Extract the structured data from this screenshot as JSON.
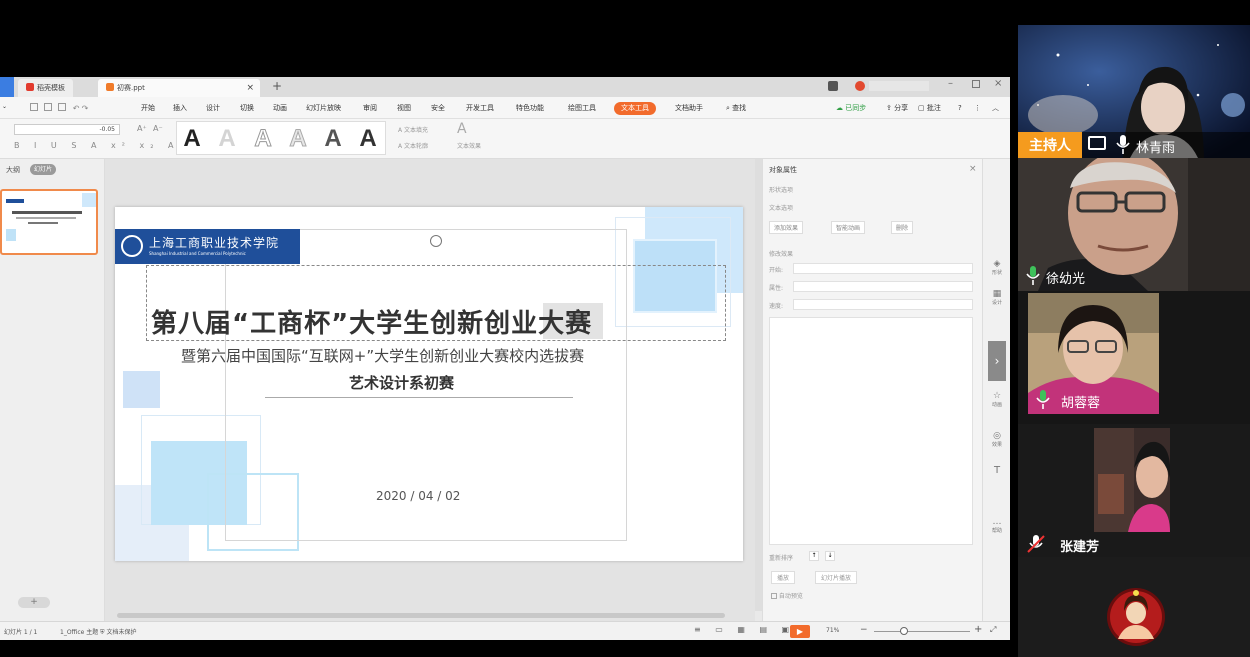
{
  "screen": {
    "tabs": [
      {
        "label": "稻壳模板"
      },
      {
        "label": "初赛.ppt"
      }
    ],
    "menu": [
      "开始",
      "插入",
      "设计",
      "切换",
      "动画",
      "幻灯片放映",
      "审阅",
      "视图",
      "安全",
      "开发工具",
      "特色功能",
      "绘图工具",
      "文本工具",
      "文档助手",
      "查找"
    ],
    "menu_right": [
      "已同步",
      "分享",
      "批注"
    ],
    "ribbon": {
      "font_size": "-0.05",
      "text_fill": "文本填充",
      "text_outline": "文本轮廓",
      "text_effect": "文本效果"
    },
    "left_panel": {
      "outline_tab": "大纲",
      "slides_tab": "幻灯片"
    },
    "slide": {
      "logo_text": "上海工商职业技术学院",
      "logo_subtext": "Shanghai Industrial and Commercial Polytechnic",
      "title": "第八届“工商杯”大学生创新创业大赛",
      "subtitle": "暨第六届中国国际“互联网+”大学生创新创业大赛校内选拔赛",
      "department": "艺术设计系初赛",
      "date": "2020 / 04 / 02"
    },
    "right_panel": {
      "header": "对象属性",
      "row1": "形状选项",
      "row2": "文本选项",
      "btn1": "添加效果",
      "btn2": "智能动画",
      "btn3": "删除",
      "section": "修改效果",
      "f1": "开始:",
      "f2": "属性:",
      "f3": "速度:",
      "reorder": "重新排序",
      "play": "播放",
      "slideshow": "幻灯片播放",
      "autopreview": "自动预览"
    },
    "rail": [
      "形状",
      "设计",
      "动画",
      "效果",
      "帮助"
    ],
    "status": {
      "page": "幻灯片 1 / 1",
      "theme": "1_Office 主题",
      "protect": "文档未保护",
      "zoom": "71%"
    }
  },
  "participants": [
    {
      "name": "林青雨",
      "host_badge": "主持人"
    },
    {
      "name": "徐幼光"
    },
    {
      "name": "胡蓉蓉"
    },
    {
      "name": "张建芳"
    },
    {
      "name": ""
    }
  ]
}
